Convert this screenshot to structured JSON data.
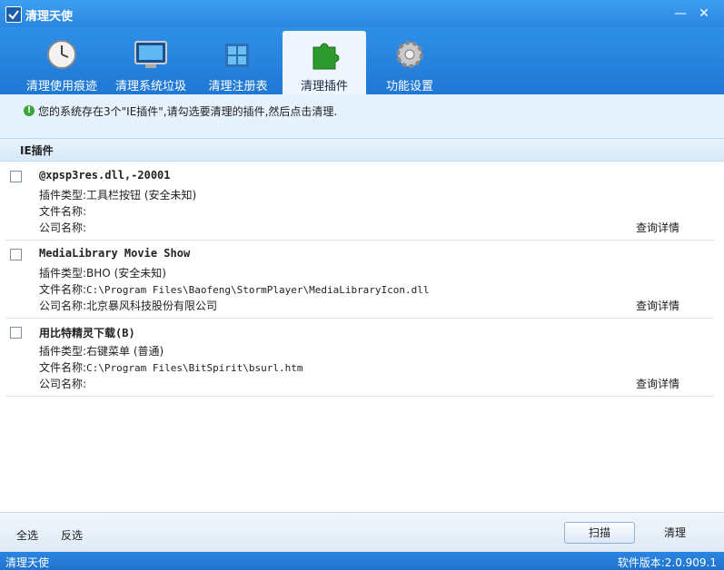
{
  "window": {
    "title": "清理天使"
  },
  "tabs": [
    {
      "label": "清理使用痕迹",
      "icon": "clock-icon"
    },
    {
      "label": "清理系统垃圾",
      "icon": "monitor-icon"
    },
    {
      "label": "清理注册表",
      "icon": "registry-icon"
    },
    {
      "label": "清理插件",
      "icon": "puzzle-icon",
      "active": true
    },
    {
      "label": "功能设置",
      "icon": "gear-icon"
    }
  ],
  "info": {
    "text": "您的系统存在3个\"IE插件\",请勾选要清理的插件,然后点击清理."
  },
  "section": {
    "title": "IE插件"
  },
  "plugins": [
    {
      "name": "@xpsp3res.dll,-20001",
      "type_label": "插件类型:",
      "type": "工具栏按钮 (安全未知)",
      "file_label": "文件名称:",
      "file": "",
      "company_label": "公司名称:",
      "company": "",
      "detail": "查询详情"
    },
    {
      "name": "MediaLibrary Movie Show",
      "type_label": "插件类型:",
      "type": "BHO (安全未知)",
      "file_label": "文件名称:",
      "file": "C:\\Program Files\\Baofeng\\StormPlayer\\MediaLibraryIcon.dll",
      "company_label": "公司名称:",
      "company": "北京暴风科技股份有限公司",
      "detail": "查询详情"
    },
    {
      "name": "用比特精灵下载(B)",
      "type_label": "插件类型:",
      "type": "右键菜单 (普通)",
      "file_label": "文件名称:",
      "file": "C:\\Program Files\\BitSpirit\\bsurl.htm",
      "company_label": "公司名称:",
      "company": "",
      "detail": "查询详情"
    }
  ],
  "footer": {
    "select_all": "全选",
    "invert": "反选",
    "scan": "扫描",
    "clean": "清理"
  },
  "status": {
    "left": "清理天使",
    "version": "软件版本:2.0.909.1"
  }
}
